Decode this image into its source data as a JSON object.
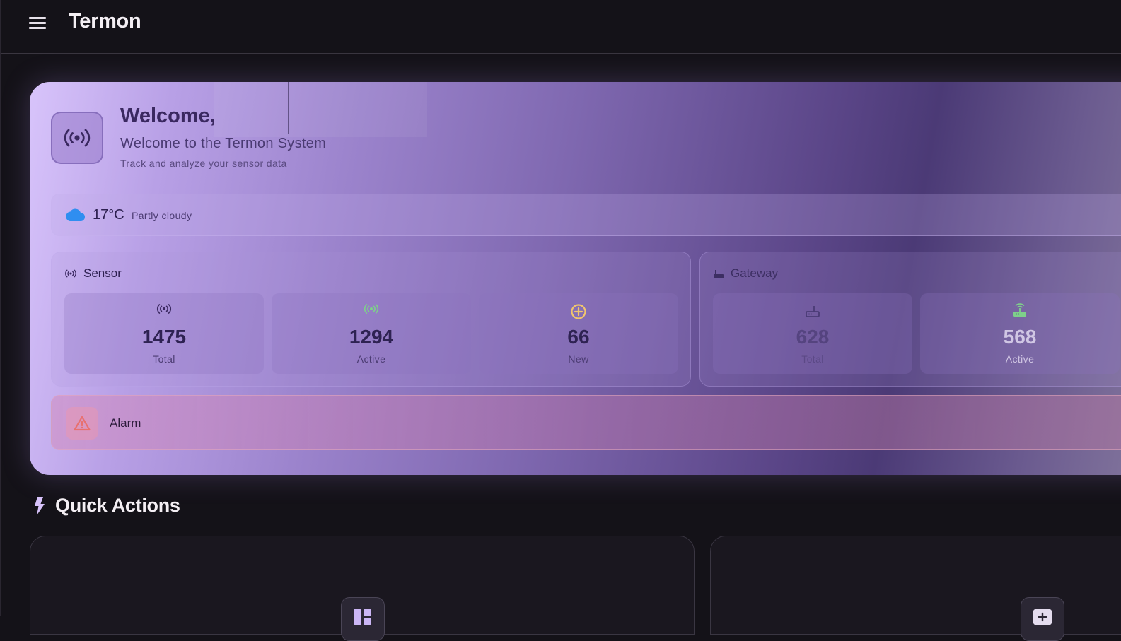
{
  "app_bar": {
    "title": "Termon",
    "menu_icon": "menu-icon"
  },
  "hero": {
    "icon": "broadcast-icon",
    "title": "Welcome,",
    "subtitle": "Welcome to the Termon System",
    "description": "Track and analyze your sensor data"
  },
  "weather": {
    "icon": "cloud-icon",
    "temperature": "17°C",
    "condition": "Partly cloudy"
  },
  "sensor": {
    "title": "Sensor",
    "icon": "broadcast-icon",
    "tiles": [
      {
        "icon": "broadcast-icon",
        "value": "1475",
        "label": "Total"
      },
      {
        "icon": "broadcast-active-icon",
        "value": "1294",
        "label": "Active"
      },
      {
        "icon": "plus-circle-icon",
        "value": "66",
        "label": "New"
      }
    ]
  },
  "gateway": {
    "title": "Gateway",
    "icon": "router-icon",
    "tiles": [
      {
        "icon": "router-icon",
        "value": "628",
        "label": "Total"
      },
      {
        "icon": "router-active-icon",
        "value": "568",
        "label": "Active"
      }
    ]
  },
  "alarm": {
    "icon": "warning-icon",
    "label": "Alarm"
  },
  "quick_actions": {
    "icon": "bolt-icon",
    "title": "Quick Actions",
    "cards": [
      {
        "icon": "dashboard-icon"
      },
      {
        "icon": "add-box-icon"
      }
    ]
  },
  "colors": {
    "background": "#141218",
    "hero_start": "#d8c4fb",
    "hero_mid": "#5a4587",
    "active_green": "#7ed08a",
    "new_amber": "#f2c66d",
    "alarm_red": "#e8706e",
    "weather_blue": "#2f8ef0"
  }
}
